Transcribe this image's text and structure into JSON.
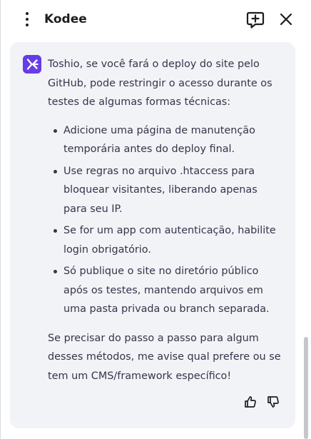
{
  "header": {
    "title": "Kodee",
    "menu_icon": "more-vertical-icon",
    "new_chat_icon": "chat-plus-icon",
    "close_icon": "close-icon"
  },
  "message": {
    "avatar_icon": "kodee-logo-icon",
    "intro": "Toshio, se você fará o deploy do site pelo GitHub, pode restringir o acesso durante os testes de algumas formas técnicas:",
    "bullets": [
      "Adicione uma página de manutenção temporária antes do deploy final.",
      "Use regras no arquivo .htaccess para bloquear visitantes, liberando apenas para seu IP.",
      "Se for um app com autenticação, habilite login obrigatório.",
      "Só publique o site no diretório público após os testes, mantendo arquivos em uma pasta privada ou branch separada."
    ],
    "outro": "Se precisar do passo a passo para algum desses métodos, me avise qual prefere ou se tem um CMS/framework específico!",
    "feedback": {
      "like_icon": "thumbs-up-icon",
      "dislike_icon": "thumbs-down-icon"
    }
  },
  "colors": {
    "accent": "#673de6",
    "card_bg": "#f2f3f6",
    "text": "#36344d"
  }
}
